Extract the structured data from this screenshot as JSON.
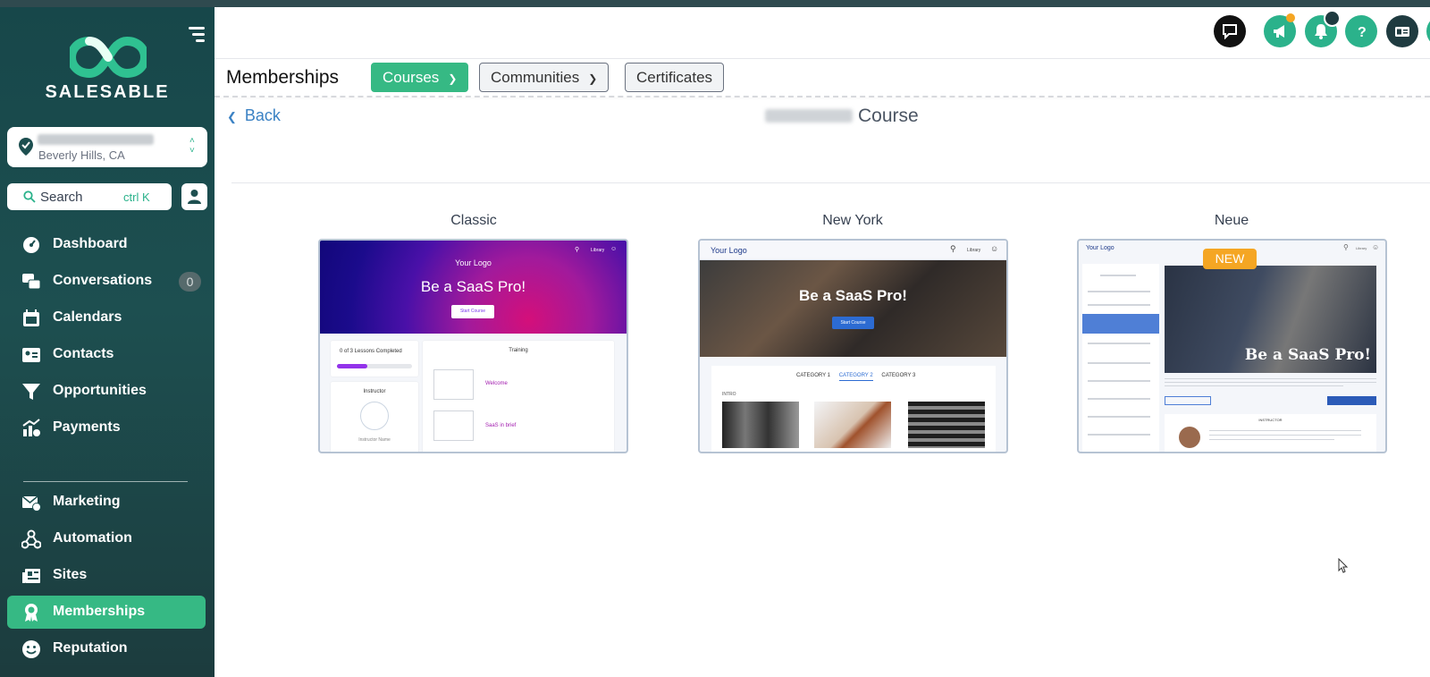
{
  "brand": {
    "name": "SALESABLE"
  },
  "location": {
    "city": "Beverly Hills, CA"
  },
  "search": {
    "label": "Search",
    "shortcut": "ctrl K"
  },
  "nav": {
    "items": [
      {
        "label": "Dashboard"
      },
      {
        "label": "Conversations",
        "badge": "0"
      },
      {
        "label": "Calendars"
      },
      {
        "label": "Contacts"
      },
      {
        "label": "Opportunities"
      },
      {
        "label": "Payments"
      },
      {
        "label": "Marketing"
      },
      {
        "label": "Automation"
      },
      {
        "label": "Sites"
      },
      {
        "label": "Memberships"
      },
      {
        "label": "Reputation"
      }
    ],
    "active": "Memberships"
  },
  "header": {
    "icons": [
      "chat-icon",
      "megaphone-icon",
      "bell-icon",
      "help-icon",
      "id-card-icon"
    ]
  },
  "subheader": {
    "title": "Memberships",
    "tabs": [
      {
        "label": "Courses",
        "active": true,
        "dropdown": true
      },
      {
        "label": "Communities",
        "active": false,
        "dropdown": true
      },
      {
        "label": "Certificates",
        "active": false,
        "dropdown": false
      }
    ]
  },
  "main": {
    "back_label": "Back",
    "course_title_suffix": "Course",
    "templates": [
      {
        "name": "Classic",
        "logo": "Your Logo",
        "heading": "Be a SaaS Pro!",
        "cta": "Start Course",
        "nav_link": "Library",
        "progress": "0 of 3 Lessons Completed",
        "progress_value": 0.4,
        "section": "Training",
        "lessons": [
          "Welcome",
          "SaaS in brief"
        ],
        "instructor_label": "Instructor",
        "instructor_name": "Instructor Name"
      },
      {
        "name": "New York",
        "logo": "Your Logo",
        "heading": "Be a SaaS Pro!",
        "cta": "Start Course",
        "nav_link": "Library",
        "categories": [
          "CATEGORY 1",
          "CATEGORY 2",
          "CATEGORY 3"
        ],
        "section": "INTRO"
      },
      {
        "name": "Neue",
        "logo": "Your Logo",
        "badge": "NEW",
        "heading": "Be a SaaS Pro!",
        "nav_link": "Library",
        "instructor_label": "INSTRUCTOR"
      }
    ]
  },
  "colors": {
    "sidebar": "#1d4f50",
    "accent": "#36b984",
    "link": "#3b82c4",
    "badge": "#f5a623"
  }
}
